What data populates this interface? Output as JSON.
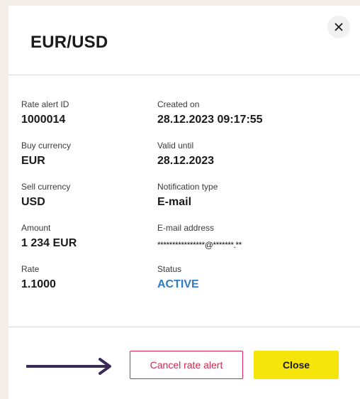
{
  "modal": {
    "title": "EUR/USD",
    "close_icon": "close-icon"
  },
  "details": {
    "rate_alert_id": {
      "label": "Rate alert ID",
      "value": "1000014"
    },
    "buy_currency": {
      "label": "Buy currency",
      "value": "EUR"
    },
    "sell_currency": {
      "label": "Sell currency",
      "value": "USD"
    },
    "amount": {
      "label": "Amount",
      "value": "1 234 EUR"
    },
    "rate": {
      "label": "Rate",
      "value": "1.1000"
    },
    "created_on": {
      "label": "Created on",
      "value": "28.12.2023 09:17:55"
    },
    "valid_until": {
      "label": "Valid until",
      "value": "28.12.2023"
    },
    "notification_type": {
      "label": "Notification type",
      "value": "E-mail"
    },
    "email_address": {
      "label": "E-mail address",
      "value": "****************@*******.**"
    },
    "status": {
      "label": "Status",
      "value": "ACTIVE"
    }
  },
  "footer": {
    "cancel_label": "Cancel rate alert",
    "close_label": "Close",
    "arrow_icon": "arrow-right-icon"
  },
  "colors": {
    "page_background": "#f3efe8",
    "status_active": "#2f7cc4",
    "cancel_accent": "#d9254f",
    "close_button": "#f5e50a",
    "arrow": "#3b2a55"
  }
}
